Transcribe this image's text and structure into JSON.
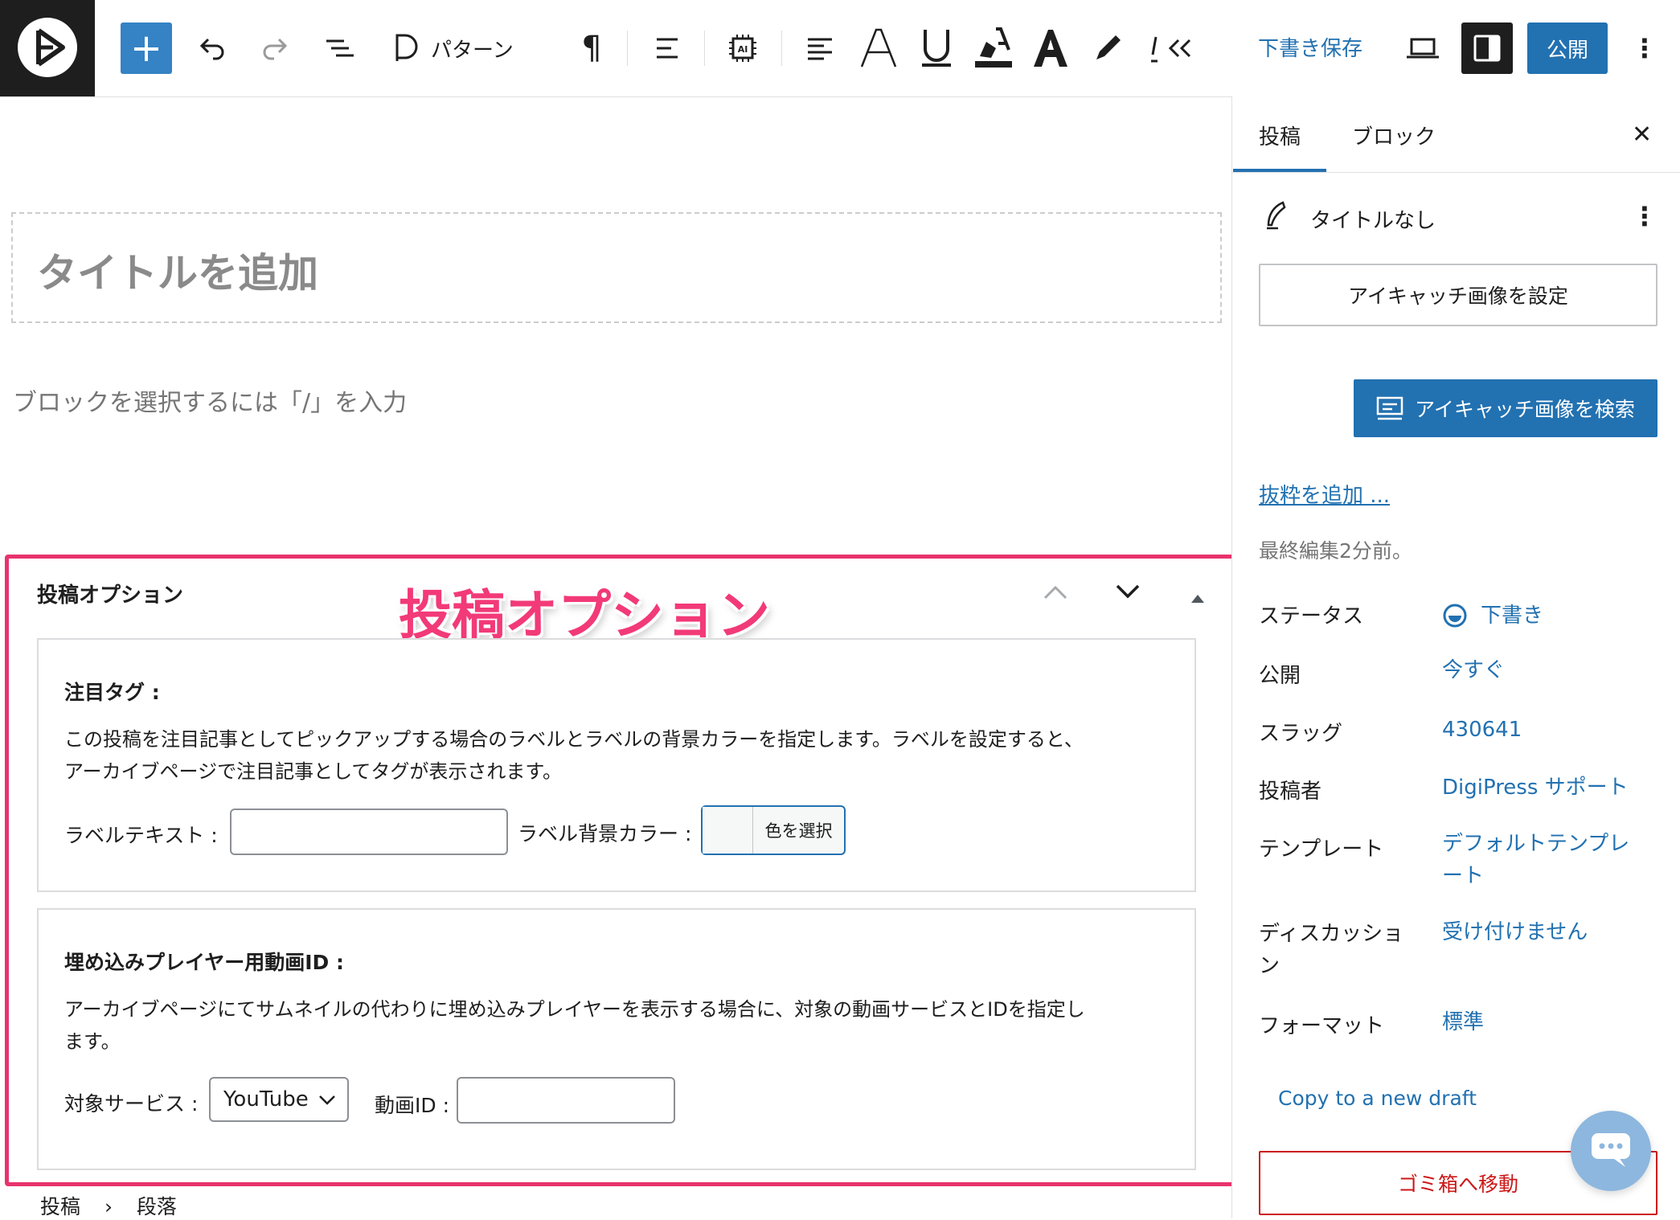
{
  "toolbar": {
    "pattern_label": "パターン",
    "save_draft": "下書き保存",
    "publish": "公開"
  },
  "editor": {
    "title_placeholder": "タイトルを追加",
    "block_hint": "ブロックを選択するには「/」を入力"
  },
  "meta_box": {
    "title": "投稿オプション",
    "overlay_label": "投稿オプション",
    "featured_tag": {
      "title": "注目タグ :",
      "description_line1": "この投稿を注目記事としてピックアップする場合のラベルとラベルの背景カラーを指定します。ラベルを設定すると、",
      "description_line2": "アーカイブページで注目記事としてタグが表示されます。",
      "label_text": "ラベルテキスト :",
      "label_value": "",
      "bg_color_label": "ラベル背景カラー :",
      "color_button": "色を選択"
    },
    "embed_player": {
      "title": "埋め込みプレイヤー用動画ID :",
      "description_line1": "アーカイブページにてサムネイルの代わりに埋め込みプレイヤーを表示する場合に、対象の動画サービスとIDを指定し",
      "description_line2": "ます。",
      "service_label": "対象サービス :",
      "service_value": "YouTube",
      "video_id_label": "動画ID :",
      "video_id_value": ""
    }
  },
  "breadcrumb": {
    "root": "投稿",
    "separator": "›",
    "current": "段落"
  },
  "sidebar": {
    "tabs": {
      "post": "投稿",
      "block": "ブロック"
    },
    "post_title": "タイトルなし",
    "set_featured": "アイキャッチ画像を設定",
    "search_featured": "アイキャッチ画像を検索",
    "add_excerpt": "抜粋を追加 ...",
    "last_edited": "最終編集2分前。",
    "rows": [
      {
        "label": "ステータス",
        "value": "下書き"
      },
      {
        "label": "公開",
        "value": "今すぐ"
      },
      {
        "label": "スラッグ",
        "value": "430641"
      },
      {
        "label": "投稿者",
        "value": "DigiPress サポート"
      },
      {
        "label": "テンプレート",
        "value": "デフォルトテンプレ",
        "value2": "ート"
      },
      {
        "label": "ディスカッショ",
        "label2": "ン",
        "value": "受け付けません"
      },
      {
        "label": "フォーマット",
        "value": "標準"
      }
    ],
    "copy_draft": "Copy to a new draft",
    "trash": "ゴミ箱へ移動"
  },
  "colors": {
    "accent": "#2271b1",
    "highlight": "#e8336d",
    "dark": "#1e1e1e"
  }
}
